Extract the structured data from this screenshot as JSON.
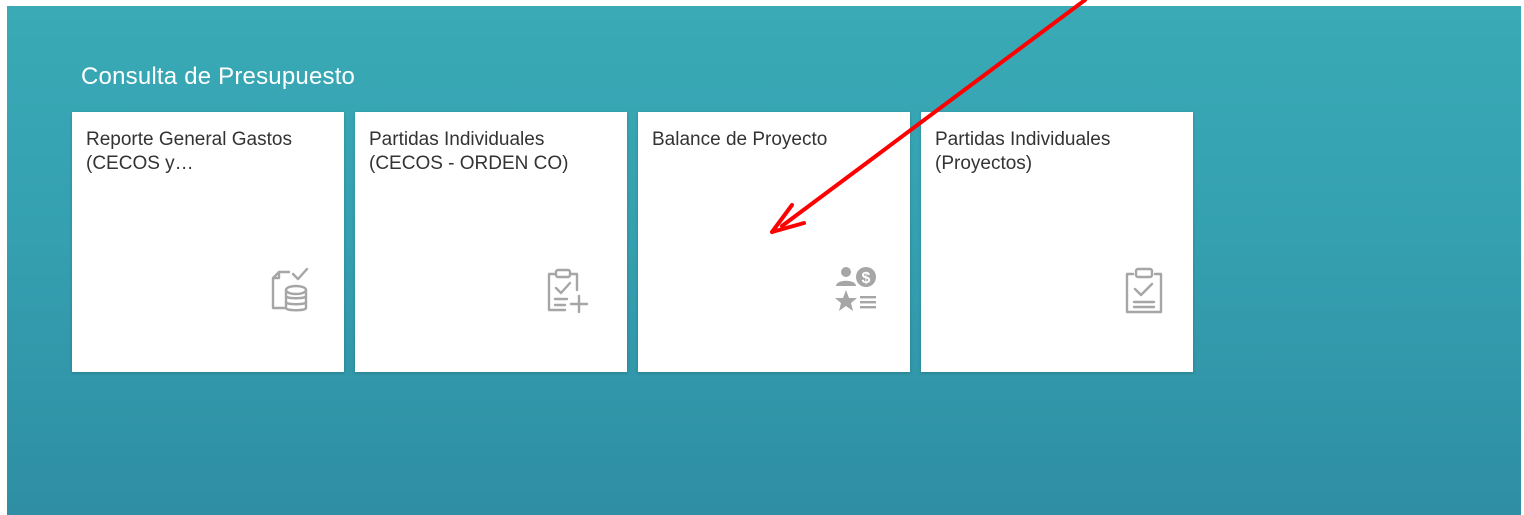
{
  "group": {
    "title": "Consulta de Presupuesto"
  },
  "tiles": [
    {
      "title": "Reporte General Gastos (CECOS y…",
      "icon": "document-database-check-icon"
    },
    {
      "title": "Partidas Individuales (CECOS - ORDEN CO)",
      "icon": "clipboard-check-add-icon"
    },
    {
      "title": "Balance de Proyecto",
      "icon": "person-dollar-star-list-icon"
    },
    {
      "title": "Partidas Individuales (Proyectos)",
      "icon": "clipboard-check-icon"
    }
  ],
  "annotation": {
    "arrow_color": "#ff0000"
  },
  "colors": {
    "background_top": "#3aaab6",
    "background_bottom": "#2f8ea4",
    "tile_background": "#ffffff",
    "tile_text": "#333333",
    "icon_gray": "#a6a6a6"
  }
}
